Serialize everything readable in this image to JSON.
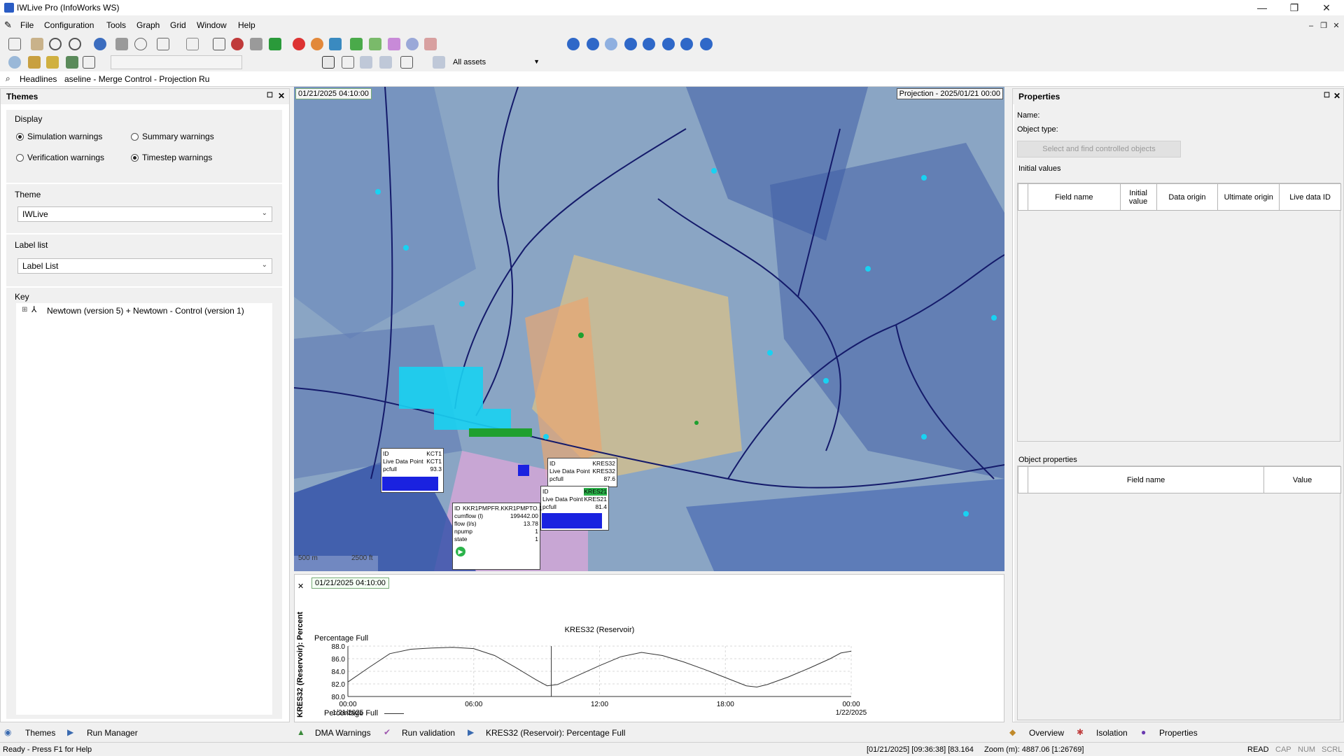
{
  "window": {
    "title": "IWLive Pro (InfoWorks WS)",
    "minimize": "—",
    "restore": "❐",
    "close": "✕"
  },
  "menubar": {
    "items": [
      "File",
      "Configuration",
      "Tools",
      "Graph",
      "Grid",
      "Window",
      "Help"
    ]
  },
  "toolbar": {
    "assets_combo": "All assets"
  },
  "headlines": {
    "label": "Headlines",
    "run_path": "aseline - Merge Control - Projection Ru"
  },
  "themes": {
    "title": "Themes",
    "display_label": "Display",
    "radios": {
      "simulation": "Simulation warnings",
      "summary": "Summary warnings",
      "verification": "Verification warnings",
      "timestep": "Timestep warnings"
    },
    "theme_label": "Theme",
    "theme_value": "IWLive",
    "labellist_label": "Label list",
    "labellist_value": "Label List",
    "key_label": "Key",
    "key_item": "Newtown (version 5) + Newtown - Control (version 1)"
  },
  "map": {
    "timestamp": "01/21/2025 04:10:00",
    "projection_label": "Projection - 2025/01/21 00:00",
    "scale_m": "500 m",
    "scale_ft": "2500 ft",
    "popup_kct1": {
      "id_label": "ID",
      "id": "KCT1",
      "type_label": "Live Data Point",
      "type_val": "KCT1",
      "field": "pcfull",
      "value": "93.3"
    },
    "popup_kres32": {
      "id_label": "ID",
      "id": "KRES32",
      "type_label": "Live Data Point",
      "type_val": "KRES32",
      "field": "pcfull",
      "value": "87.6"
    },
    "popup_kres21": {
      "id_label": "ID",
      "id": "KRES21",
      "type_label": "Live Data Point",
      "type_val": "KRES21",
      "field": "pcfull",
      "value": "81.4"
    },
    "popup_pump": {
      "id_label": "ID",
      "id": "KKR1PMPFR.KKR1PMPTO.1",
      "rows": [
        [
          "cumflow (l)",
          "199442.00"
        ],
        [
          "flow (l/s)",
          "13.78"
        ],
        [
          "npump",
          "1"
        ],
        [
          "state",
          "1"
        ]
      ]
    }
  },
  "graph": {
    "timestamp": "01/21/2025 04:10:00",
    "side_label": "KRES32 (Reservoir): Percent",
    "legend": "Percentage Full"
  },
  "chart_data": {
    "type": "line",
    "title": "KRES32 (Reservoir)",
    "ylabel": "Percentage Full",
    "ylim": [
      80.0,
      88.0
    ],
    "yticks": [
      "88.0",
      "86.0",
      "84.0",
      "82.0",
      "80.0"
    ],
    "xticks": [
      [
        "00:00",
        "1/21/2025"
      ],
      [
        "06:00",
        ""
      ],
      [
        "12:00",
        ""
      ],
      [
        "18:00",
        ""
      ],
      [
        "00:00",
        "1/22/2025"
      ]
    ],
    "x_hours": [
      0,
      1,
      2,
      3,
      4,
      5,
      6,
      7,
      8,
      9,
      9.5,
      10,
      11,
      12,
      13,
      14,
      15,
      16,
      17,
      18,
      19,
      19.5,
      20,
      21,
      22,
      23,
      23.5,
      24
    ],
    "series": [
      {
        "name": "Percentage Full",
        "values": [
          82.3,
          84.6,
          86.8,
          87.5,
          87.7,
          87.8,
          87.6,
          86.5,
          84.6,
          82.6,
          81.7,
          81.9,
          83.4,
          84.9,
          86.3,
          87.0,
          86.5,
          85.5,
          84.3,
          83.0,
          81.7,
          81.5,
          81.9,
          83.1,
          84.5,
          86.0,
          86.9,
          87.2
        ]
      }
    ],
    "cursor_hour": 9.7,
    "grid": true
  },
  "bottom_tabs": {
    "themes": "Themes",
    "run_manager": "Run Manager",
    "dma": "DMA Warnings",
    "validation": "Run validation",
    "graph_tab": "KRES32 (Reservoir): Percentage Full",
    "overview": "Overview",
    "isolation": "Isolation",
    "properties": "Properties"
  },
  "properties": {
    "title": "Properties",
    "name_label": "Name:",
    "type_label": "Object type:",
    "select_button": "Select and find controlled objects",
    "initial_values": "Initial values",
    "initial_cols": [
      "Field name",
      "Initial value",
      "Data origin",
      "Ultimate origin",
      "Live data ID"
    ],
    "object_props": "Object properties",
    "object_cols": [
      "Field name",
      "Value"
    ]
  },
  "status": {
    "left": "Ready - Press F1 for Help",
    "center": "[01/21/2025] [09:36:38] [83.164",
    "zoom": "Zoom (m): 4887.06 [1:26769]",
    "indicators": [
      "READ",
      "CAP",
      "NUM",
      "SCRL"
    ]
  },
  "colors": {
    "accent": "#1f3a8a",
    "map_water": "#19d0f0",
    "bar": "#1a22e0"
  }
}
